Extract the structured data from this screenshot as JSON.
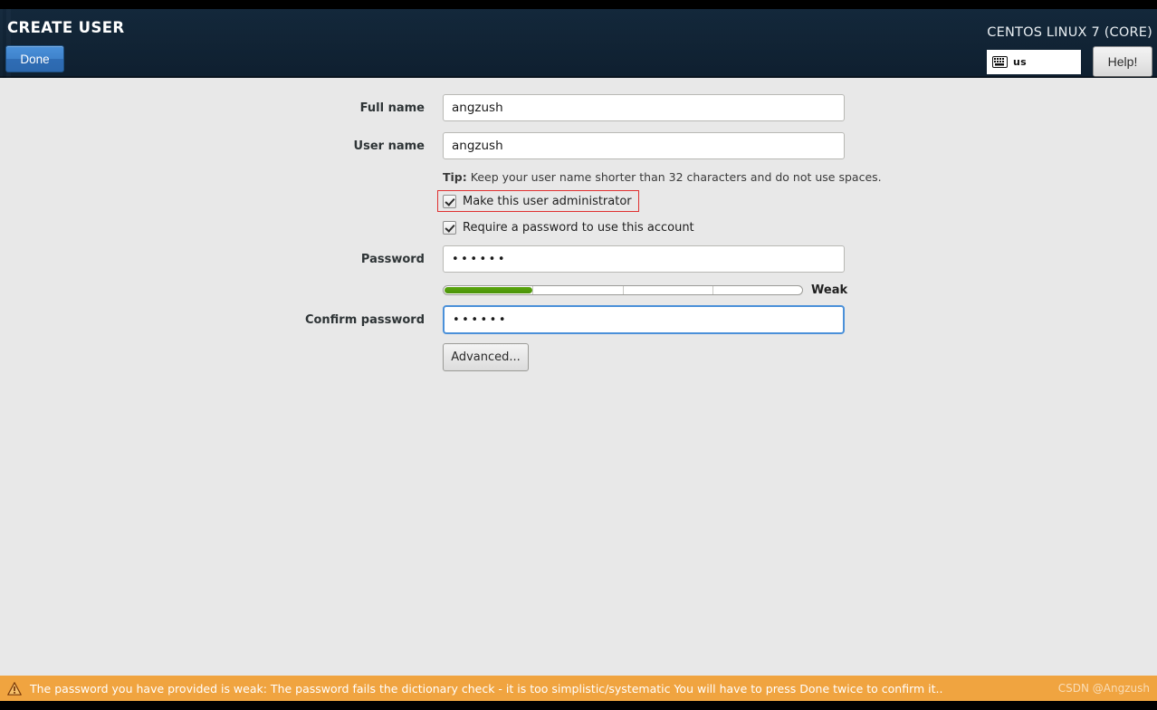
{
  "header": {
    "title": "CREATE USER",
    "done_label": "Done",
    "distro": "CENTOS LINUX 7 (CORE)",
    "keyboard_layout": "us",
    "keyboard_icon": "keyboard-icon",
    "help_label": "Help!",
    "accent_blue": "#4a90d9",
    "background": "#122537"
  },
  "form": {
    "full_name": {
      "label": "Full name",
      "value": "angzush",
      "placeholder": ""
    },
    "user_name": {
      "label": "User name",
      "value": "angzush",
      "placeholder": ""
    },
    "tip_prefix": "Tip:",
    "tip_text": " Keep your user name shorter than 32 characters and do not use spaces.",
    "admin_checkbox": {
      "label": "Make this user administrator",
      "checked": true,
      "highlight_color": "#e03030"
    },
    "require_password_checkbox": {
      "label": "Require a password to use this account",
      "checked": true
    },
    "password": {
      "label": "Password",
      "value": "••••••"
    },
    "strength": {
      "text": "Weak",
      "percent": 25,
      "segments": 4,
      "fill_color": "#4a9209"
    },
    "confirm_password": {
      "label": "Confirm password",
      "value": "••••••",
      "focused": true
    },
    "advanced_label": "Advanced..."
  },
  "status": {
    "icon": "warning-triangle-icon",
    "message": "The password you have provided is weak: The password fails the dictionary check - it is too simplistic/systematic You will have to press Done twice to confirm it..",
    "background": "#f0a440",
    "watermark": "CSDN @Angzush"
  }
}
